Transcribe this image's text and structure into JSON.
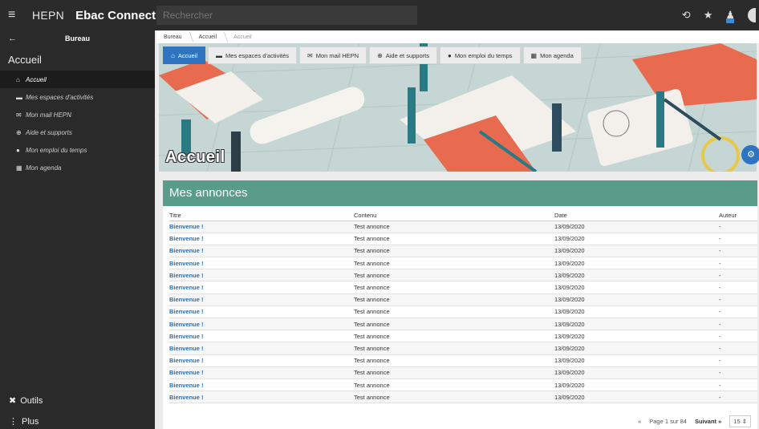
{
  "topbar": {
    "menu_icon": "hamburger-icon",
    "logo_text": "HEPN",
    "app_name": "Ebac Connect",
    "search_placeholder": "Rechercher",
    "icons": [
      "history-icon",
      "star-icon",
      "bell-icon",
      "avatar"
    ]
  },
  "sidebar": {
    "back_icon": "arrow-left-icon",
    "header": "Bureau",
    "title": "Accueil",
    "items": [
      {
        "label": "Accueil",
        "icon": "home-icon"
      },
      {
        "label": "Mes espaces d'activités",
        "icon": "folder-icon"
      },
      {
        "label": "Mon mail HEPN",
        "icon": "mail-icon"
      },
      {
        "label": "Aide et supports",
        "icon": "lifebuoy-icon"
      },
      {
        "label": "Mon emploi du temps",
        "icon": "clock-icon"
      },
      {
        "label": "Mon agenda",
        "icon": "calendar-icon"
      }
    ],
    "bottom": [
      {
        "label": "Outils",
        "icon": "tools-icon"
      },
      {
        "label": "Plus",
        "icon": "more-vertical-icon"
      }
    ]
  },
  "breadcrumb": [
    "Bureau",
    "Accueil",
    "Accueil"
  ],
  "hero": {
    "title": "Accueil",
    "nav": [
      "Accueil",
      "Mes espaces d'activités",
      "Mon mail HEPN",
      "Aide et supports",
      "Mon emploi du temps",
      "Mon agenda"
    ]
  },
  "announcements": {
    "title": "Mes annonces",
    "columns": [
      "Titre",
      "Contenu",
      "Date",
      "Auteur"
    ],
    "rows": [
      [
        "Bienvenue !",
        "Test annonce",
        "13/09/2020",
        "-"
      ],
      [
        "Bienvenue !",
        "Test annonce",
        "13/09/2020",
        "-"
      ],
      [
        "Bienvenue !",
        "Test annonce",
        "13/09/2020",
        "-"
      ],
      [
        "Bienvenue !",
        "Test annonce",
        "13/09/2020",
        "-"
      ],
      [
        "Bienvenue !",
        "Test annonce",
        "13/09/2020",
        "-"
      ],
      [
        "Bienvenue !",
        "Test annonce",
        "13/09/2020",
        "-"
      ],
      [
        "Bienvenue !",
        "Test annonce",
        "13/09/2020",
        "-"
      ],
      [
        "Bienvenue !",
        "Test annonce",
        "13/09/2020",
        "-"
      ],
      [
        "Bienvenue !",
        "Test annonce",
        "13/09/2020",
        "-"
      ],
      [
        "Bienvenue !",
        "Test annonce",
        "13/09/2020",
        "-"
      ],
      [
        "Bienvenue !",
        "Test annonce",
        "13/09/2020",
        "-"
      ],
      [
        "Bienvenue !",
        "Test annonce",
        "13/09/2020",
        "-"
      ],
      [
        "Bienvenue !",
        "Test annonce",
        "13/09/2020",
        "-"
      ],
      [
        "Bienvenue !",
        "Test annonce",
        "13/09/2020",
        "-"
      ],
      [
        "Bienvenue !",
        "Test annonce",
        "13/09/2020",
        "-"
      ]
    ],
    "pager": {
      "first": "«",
      "page_info": "Page 1 sur 84",
      "next": "Suivant »",
      "page_size": "15 ⇕"
    }
  },
  "colors": {
    "accent": "#2f74c0",
    "card_header": "#5a9c8a",
    "sidebar": "#2a2a2a",
    "topbar": "#2b2b2b"
  }
}
